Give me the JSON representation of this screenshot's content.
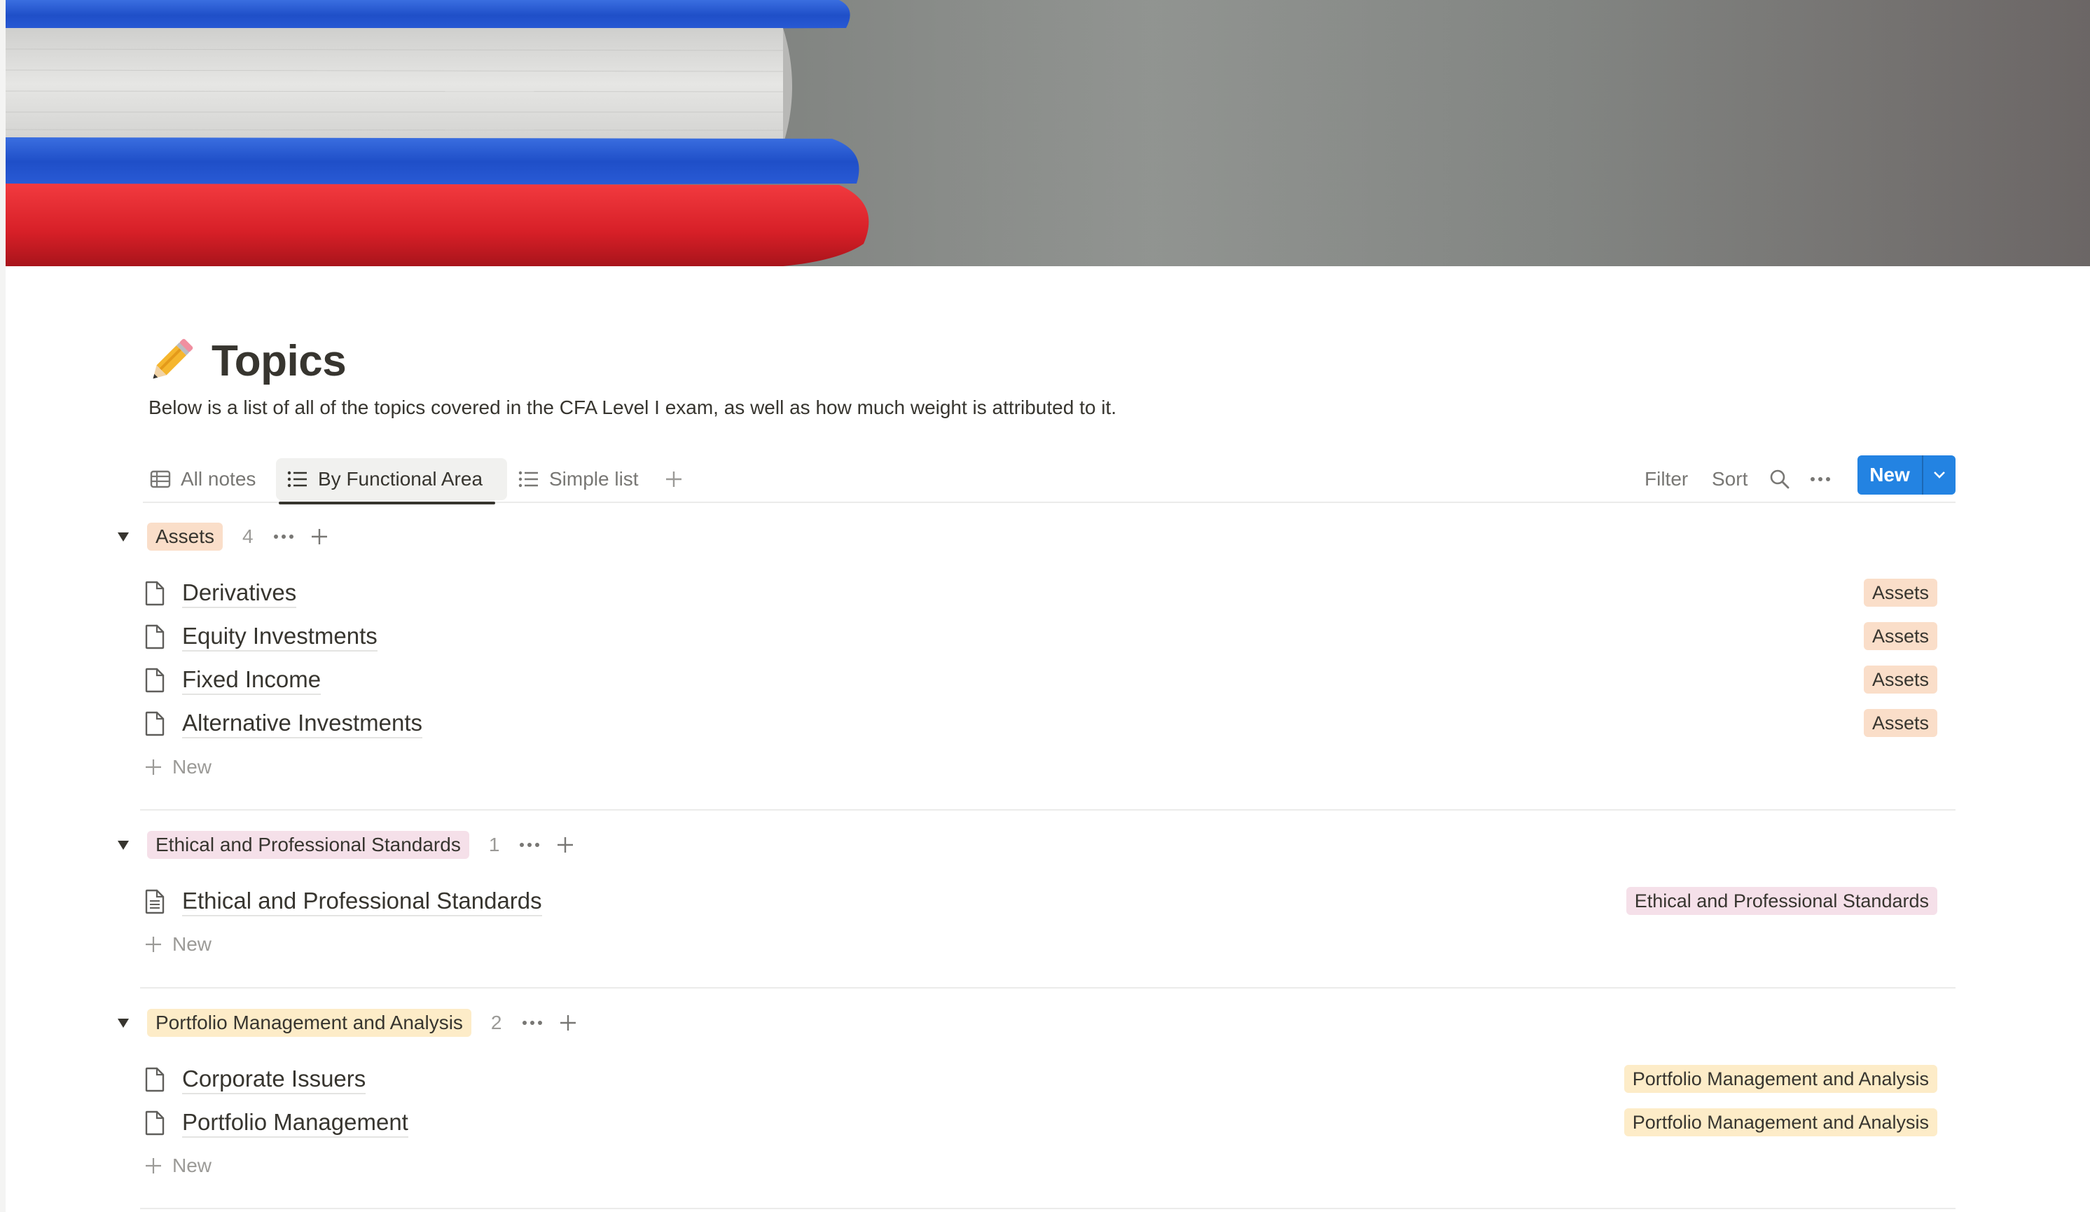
{
  "page": {
    "title": "Topics",
    "title_icon": "pencil-icon",
    "description": "Below is a list of all of the topics covered in the CFA Level I exam, as well as how much weight is attributed to it."
  },
  "views": {
    "tabs": [
      {
        "label": "All notes",
        "icon": "table-icon",
        "active": false
      },
      {
        "label": "By Functional Area",
        "icon": "list-icon",
        "active": true
      },
      {
        "label": "Simple list",
        "icon": "list-icon",
        "active": false
      }
    ],
    "add_view_icon": "plus-icon"
  },
  "toolbar": {
    "filter_label": "Filter",
    "sort_label": "Sort",
    "search_icon": "search-icon",
    "more_icon": "more-icon",
    "new_label": "New"
  },
  "groups": [
    {
      "tag": "Assets",
      "color": "#fadec9",
      "count": "4",
      "rows": [
        {
          "title": "Derivatives",
          "tag": "Assets"
        },
        {
          "title": "Equity Investments",
          "tag": "Assets"
        },
        {
          "title": "Fixed Income",
          "tag": "Assets"
        },
        {
          "title": "Alternative Investments",
          "tag": "Assets"
        }
      ],
      "new_label": "New"
    },
    {
      "tag": "Ethical and Professional Standards",
      "color": "#f5e0e9",
      "count": "1",
      "rows": [
        {
          "title": "Ethical and Professional Standards",
          "tag": "Ethical and Professional Standards"
        }
      ],
      "new_label": "New"
    },
    {
      "tag": "Portfolio Management and Analysis",
      "color": "#fdecc8",
      "count": "2",
      "rows": [
        {
          "title": "Corporate Issuers",
          "tag": "Portfolio Management and Analysis"
        },
        {
          "title": "Portfolio Management",
          "tag": "Portfolio Management and Analysis"
        }
      ],
      "new_label": "New"
    }
  ],
  "colors": {
    "accent": "#2383e2",
    "text": "#37352f",
    "muted": "#787774"
  }
}
